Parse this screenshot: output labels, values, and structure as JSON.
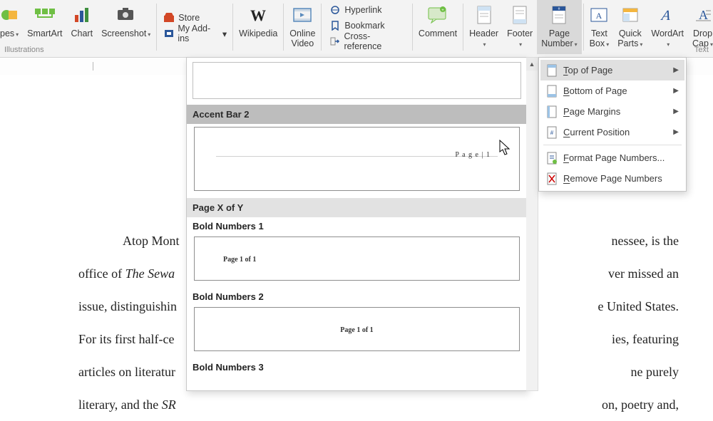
{
  "ribbon": {
    "shapes": "pes",
    "smartart": "SmartArt",
    "chart": "Chart",
    "screenshot": "Screenshot",
    "store": "Store",
    "myaddins": "My Add-ins",
    "wikipedia": "Wikipedia",
    "onlinevideo_l1": "Online",
    "onlinevideo_l2": "Video",
    "hyperlink": "Hyperlink",
    "bookmark": "Bookmark",
    "crossref": "Cross-reference",
    "comment": "Comment",
    "header": "Header",
    "footer": "Footer",
    "pagenum_l1": "Page",
    "pagenum_l2": "Number",
    "textbox_l1": "Text",
    "textbox_l2": "Box",
    "quickparts_l1": "Quick",
    "quickparts_l2": "Parts",
    "wordart": "WordArt",
    "dropcap_l1": "Drop",
    "dropcap_l2": "Cap",
    "group_illus": "Illustrations",
    "group_text": "Text"
  },
  "menu": {
    "top": "Top of Page",
    "bottom": "Bottom of Page",
    "margins": "Page Margins",
    "current": "Current Position",
    "format": "Format Page Numbers...",
    "remove": "Remove Page Numbers",
    "top_u": "T",
    "bottom_u": "B",
    "margins_u": "P",
    "current_u": "C",
    "format_u": "F",
    "remove_u": "R"
  },
  "gallery": {
    "accent": "Accent Bar 2",
    "accent_tag": "P a g e  | 1",
    "xy": "Page X of Y",
    "bold1": "Bold Numbers 1",
    "bold1_tag": "Page 1 of 1",
    "bold2": "Bold Numbers 2",
    "bold2_tag": "Page 1 of 1",
    "bold3": "Bold Numbers 3"
  },
  "doc": {
    "l1a": "Atop Mont",
    "l1b": "nessee, is the",
    "l2a": "office of ",
    "l2a_i": "The Sewa",
    "l2b": "ver missed an",
    "l3a": "issue, distinguishin",
    "l3b": "e United States.",
    "l4a": "For its first half-ce",
    "l4b": "ies, featuring",
    "l5a": "articles on literatur",
    "l5b": "ne purely",
    "l6a": "literary, and the ",
    "l6a_i": "SR",
    "l6b": "on, poetry and,"
  }
}
